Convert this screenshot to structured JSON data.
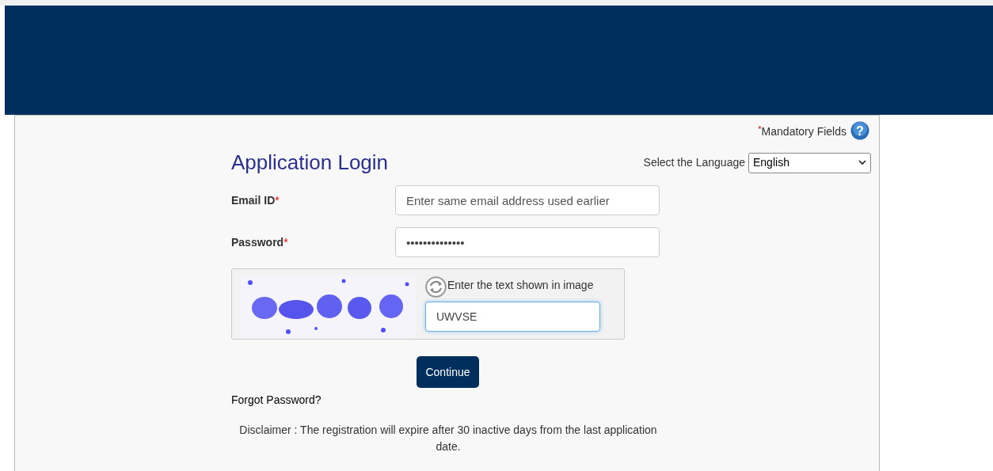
{
  "mandatory_note": {
    "asterisk": "*",
    "label": "Mandatory Fields",
    "help_glyph": "?"
  },
  "title": "Application Login",
  "language": {
    "label": "Select the Language",
    "value": "English"
  },
  "fields": [
    {
      "label": "Email ID",
      "required_mark": "*",
      "placeholder": "Enter same email address used earlier"
    },
    {
      "label": "Password",
      "required_mark": "*",
      "value": "••••••••••••••"
    }
  ],
  "captcha": {
    "prompt": "Enter the text shown in image",
    "value": "UWVSE",
    "focused": true
  },
  "continue_button": "Continue",
  "forgot_link": "Forgot Password?",
  "disclaimer": "Disclaimer : The registration will expire after 30 inactive days from the last application date."
}
